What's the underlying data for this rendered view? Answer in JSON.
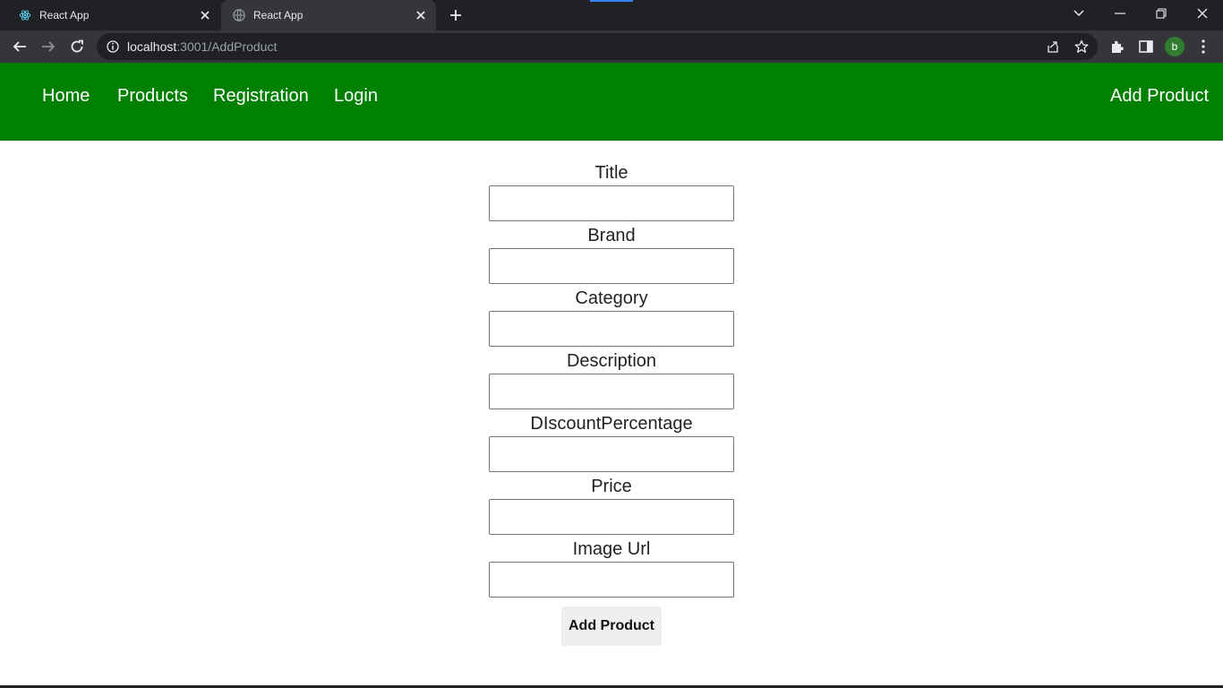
{
  "browser": {
    "tabs": [
      {
        "title": "React App",
        "favicon": "react-logo-icon",
        "active": false
      },
      {
        "title": "React App",
        "favicon": "globe-icon",
        "active": true
      }
    ],
    "url_host": "localhost",
    "url_path": ":3001/AddProduct",
    "profile_initial": "b",
    "profile_color": "#2e7d32"
  },
  "nav": {
    "links": [
      "Home",
      "Products",
      "Registration",
      "Login"
    ],
    "right_link": "Add Product",
    "background": "#008000"
  },
  "form": {
    "fields": [
      {
        "label": "Title",
        "value": ""
      },
      {
        "label": "Brand",
        "value": ""
      },
      {
        "label": "Category",
        "value": ""
      },
      {
        "label": "Description",
        "value": ""
      },
      {
        "label": "DIscountPercentage",
        "value": ""
      },
      {
        "label": "Price",
        "value": ""
      },
      {
        "label": "Image Url",
        "value": ""
      }
    ],
    "submit_label": "Add Product"
  }
}
